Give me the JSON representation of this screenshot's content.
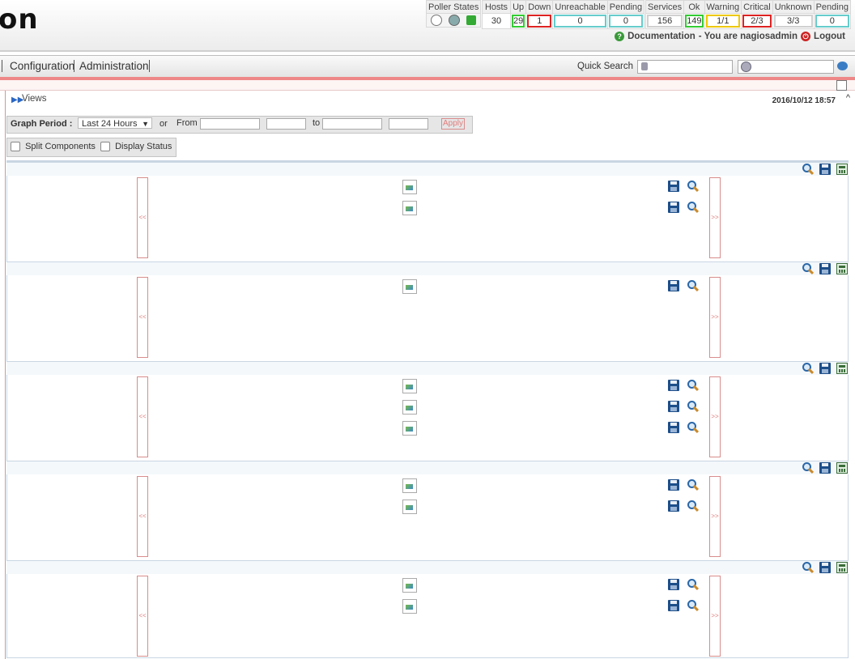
{
  "header": {
    "logo_text": "on",
    "poller_label": "Poller States",
    "hosts": {
      "label": "Hosts",
      "total": "30",
      "up_label": "Up",
      "up": "29",
      "down_label": "Down",
      "down": "1",
      "unreachable_label": "Unreachable",
      "unreachable": "0",
      "pending_label": "Pending",
      "pending": "0"
    },
    "services": {
      "label": "Services",
      "total": "156",
      "ok_label": "Ok",
      "ok": "149",
      "warning_label": "Warning",
      "warning": "1/1",
      "critical_label": "Critical",
      "critical": "2/3",
      "unknown_label": "Unknown",
      "unknown": "3/3",
      "pending_label": "Pending",
      "pending": "0"
    },
    "documentation_label": "Documentation",
    "user_text": "- You are nagiosadmin",
    "logout_label": "Logout"
  },
  "menu": {
    "items": [
      "Configuration",
      "Administration"
    ],
    "quick_search_label": "Quick Search"
  },
  "views": {
    "title": "Views",
    "datetime": "2016/10/12 18:57",
    "graph_period_label": "Graph Period :",
    "period_value": "Last 24 Hours",
    "or_label": "or",
    "from_label": "From",
    "to_label": "to",
    "apply_label": "Apply",
    "split_components_label": "Split Components",
    "display_status_label": "Display Status",
    "prev_label": "<<",
    "next_label": ">>"
  },
  "colors": {
    "ok": "#33cc33",
    "critical": "#dd2222",
    "pending": "#66cccc",
    "warning": "#eec800",
    "accent_line": "#e88888"
  },
  "panels": [
    {
      "graph_count": 2
    },
    {
      "graph_count": 1
    },
    {
      "graph_count": 3
    },
    {
      "graph_count": 2
    },
    {
      "graph_count": 2
    }
  ]
}
